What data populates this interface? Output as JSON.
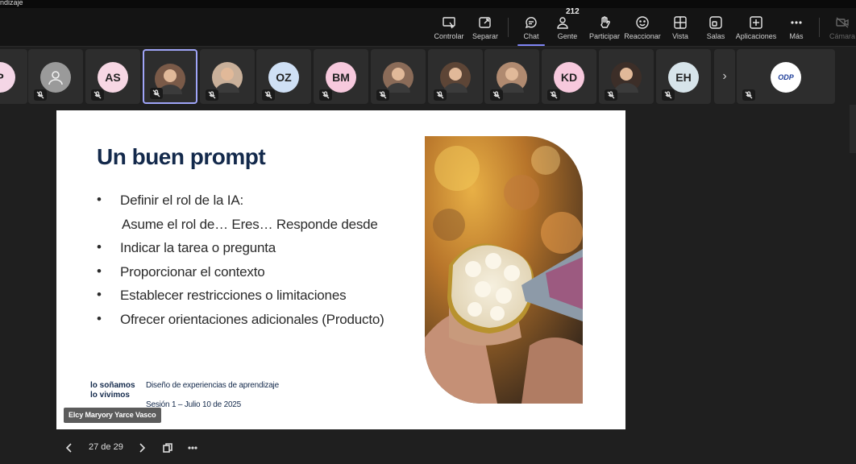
{
  "window": {
    "title_fragment": "ndizaje"
  },
  "toolbar": {
    "items": [
      {
        "label": "Controlar",
        "icon": "control-icon"
      },
      {
        "label": "Separar",
        "icon": "popout-icon"
      },
      {
        "label": "Chat",
        "icon": "chat-icon",
        "active": true
      },
      {
        "label": "Gente",
        "icon": "people-icon",
        "count": "212"
      },
      {
        "label": "Participar",
        "icon": "raise-hand-icon"
      },
      {
        "label": "Reaccionar",
        "icon": "smile-icon"
      },
      {
        "label": "Vista",
        "icon": "grid-view-icon"
      },
      {
        "label": "Salas",
        "icon": "rooms-icon"
      },
      {
        "label": "Aplicaciones",
        "icon": "add-app-icon"
      },
      {
        "label": "Más",
        "icon": "more-icon"
      },
      {
        "label": "Cámara",
        "icon": "camera-off-icon",
        "disabled": true
      }
    ]
  },
  "participants": [
    {
      "initials": "P",
      "color": "#f4d6e6",
      "kind": "initials"
    },
    {
      "initials": "",
      "color": "#9a9a9a",
      "kind": "generic"
    },
    {
      "initials": "AS",
      "color": "#f7d7e4",
      "kind": "initials"
    },
    {
      "initials": "",
      "color": "#7a5a48",
      "kind": "photo",
      "active": true
    },
    {
      "initials": "",
      "color": "#c9b09a",
      "kind": "photo"
    },
    {
      "initials": "OZ",
      "color": "#cfe0f5",
      "kind": "initials"
    },
    {
      "initials": "BM",
      "color": "#f7c9dd",
      "kind": "initials"
    },
    {
      "initials": "",
      "color": "#8a6b58",
      "kind": "photo"
    },
    {
      "initials": "",
      "color": "#5d4536",
      "kind": "photo"
    },
    {
      "initials": "",
      "color": "#b08a70",
      "kind": "photo"
    },
    {
      "initials": "KD",
      "color": "#f7c9dd",
      "kind": "initials"
    },
    {
      "initials": "",
      "color": "#3c2e28",
      "kind": "photo"
    },
    {
      "initials": "EH",
      "color": "#d7e4ea",
      "kind": "initials"
    },
    {
      "initials": "ODP",
      "color": "#ffffff",
      "kind": "logo"
    }
  ],
  "slide": {
    "title": "Un buen prompt",
    "bullets": [
      {
        "text": "Definir el rol de la IA:",
        "type": "dot"
      },
      {
        "text": "Asume el rol de… Eres… Responde desde",
        "type": "sub"
      },
      {
        "text": "Indicar la tarea o pregunta",
        "type": "dot"
      },
      {
        "text": "Proporcionar el contexto",
        "type": "dot"
      },
      {
        "text": "Establecer restricciones o limitaciones",
        "type": "dot"
      },
      {
        "text": "Ofrecer orientaciones adicionales (Producto)",
        "type": "dot"
      }
    ],
    "brand_line1": "lo soñamos",
    "brand_line2": "lo vivimos",
    "course": "Diseño de experiencias de aprendizaje",
    "session": "Sesión 1 – Julio 10 de 2025"
  },
  "presenter_name": "Elcy Maryory Yarce Vasco",
  "pager": {
    "text": "27 de 29"
  },
  "colors": {
    "accent": "#7f85f5",
    "slide_title": "#13294b"
  }
}
